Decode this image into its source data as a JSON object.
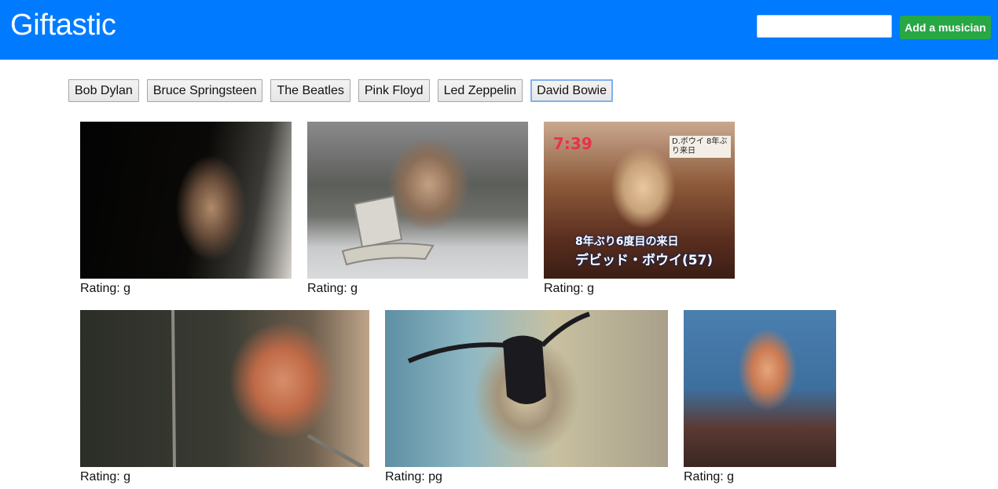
{
  "header": {
    "brand": "Giftastic",
    "search_placeholder": "",
    "search_value": "",
    "add_button_label": "Add a musician",
    "brand_color": "#007bff",
    "add_button_color": "#28a745"
  },
  "musicians": [
    "Bob Dylan",
    "Bruce Springsteen",
    "The Beatles",
    "Pink Floyd",
    "Led Zeppelin",
    "David Bowie"
  ],
  "selected_musician": "David Bowie",
  "gifs": [
    {
      "rating": "Rating: g"
    },
    {
      "rating": "Rating: g"
    },
    {
      "rating": "Rating: g",
      "overlay_time": "7:39",
      "overlay_caption": "8年ぶり6度目の来日",
      "overlay_name": "デビッド・ボウイ(57)",
      "overlay_corner": "D.ボウイ 8年ぶり来日"
    },
    {
      "rating": "Rating: g"
    },
    {
      "rating": "Rating: pg"
    },
    {
      "rating": "Rating: g"
    }
  ]
}
